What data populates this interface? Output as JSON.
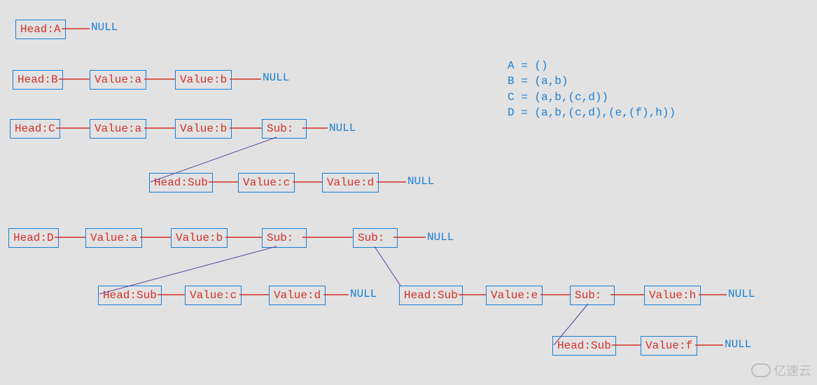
{
  "legend": {
    "A": "A = ()",
    "B": "B = (a,b)",
    "C": "C = (a,b,(c,d))",
    "D": "D = (a,b,(c,d),(e,(f),h))"
  },
  "null_label": "NULL",
  "logo": "亿速云",
  "rows": {
    "A": {
      "head": "Head:A"
    },
    "B": {
      "head": "Head:B",
      "v1": "Value:a",
      "v2": "Value:b"
    },
    "C": {
      "head": "Head:C",
      "v1": "Value:a",
      "v2": "Value:b",
      "sub": "Sub:",
      "sub_head": "Head:Sub",
      "sv1": "Value:c",
      "sv2": "Value:d"
    },
    "D": {
      "head": "Head:D",
      "v1": "Value:a",
      "v2": "Value:b",
      "sub1": "Sub:",
      "sub2": "Sub:",
      "sub1_head": "Head:Sub",
      "sub1_v1": "Value:c",
      "sub1_v2": "Value:d",
      "sub2_head": "Head:Sub",
      "sub2_v1": "Value:e",
      "sub2_sub": "Sub:",
      "sub2_v2": "Value:h",
      "sub2_sub_head": "Head:Sub",
      "sub2_sub_v": "Value:f"
    }
  },
  "chart_data": {
    "type": "table",
    "title": "Generalized List Node Structures",
    "lists": [
      {
        "name": "A",
        "expr": "()",
        "nodes": [
          "Head:A",
          "NULL"
        ]
      },
      {
        "name": "B",
        "expr": "(a,b)",
        "nodes": [
          "Head:B",
          "Value:a",
          "Value:b",
          "NULL"
        ]
      },
      {
        "name": "C",
        "expr": "(a,b,(c,d))",
        "nodes": [
          "Head:C",
          "Value:a",
          "Value:b",
          {
            "Sub": [
              "Head:Sub",
              "Value:c",
              "Value:d",
              "NULL"
            ]
          },
          "NULL"
        ]
      },
      {
        "name": "D",
        "expr": "(a,b,(c,d),(e,(f),h))",
        "nodes": [
          "Head:D",
          "Value:a",
          "Value:b",
          {
            "Sub": [
              "Head:Sub",
              "Value:c",
              "Value:d",
              "NULL"
            ]
          },
          {
            "Sub": [
              "Head:Sub",
              "Value:e",
              {
                "Sub": [
                  "Head:Sub",
                  "Value:f",
                  "NULL"
                ]
              },
              "Value:h",
              "NULL"
            ]
          },
          "NULL"
        ]
      }
    ]
  }
}
